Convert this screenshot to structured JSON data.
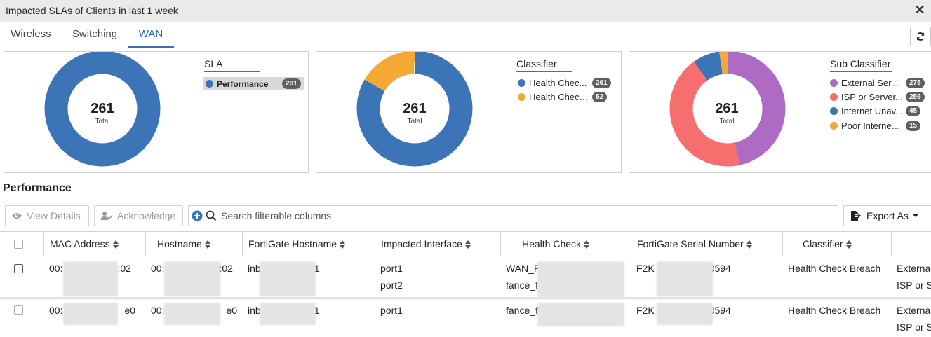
{
  "title_bar": {
    "title": "Impacted SLAs of Clients in last 1 week"
  },
  "tabs": [
    {
      "label": "Wireless",
      "active": false
    },
    {
      "label": "Switching",
      "active": false
    },
    {
      "label": "WAN",
      "active": true
    }
  ],
  "cards": [
    {
      "legend_title": "SLA",
      "center_value": "261",
      "center_label": "Total",
      "items": [
        {
          "label": "Performance",
          "count": "261",
          "color": "#3b74b7"
        }
      ]
    },
    {
      "legend_title": "Classifier",
      "center_value": "261",
      "center_label": "Total",
      "items": [
        {
          "label": "Health Chec...",
          "count": "261",
          "color": "#3b74b7"
        },
        {
          "label": "Health Check ...",
          "count": "52",
          "color": "#f5a935"
        }
      ]
    },
    {
      "legend_title": "Sub Classifier",
      "center_value": "261",
      "center_label": "Total",
      "items": [
        {
          "label": "External Ser...",
          "count": "275",
          "color": "#ad6bc4"
        },
        {
          "label": "ISP or Server...",
          "count": "256",
          "color": "#f76e6e"
        },
        {
          "label": "Internet Unav...",
          "count": "45",
          "color": "#3b74b7"
        },
        {
          "label": "Poor Internet ...",
          "count": "15",
          "color": "#f5a935"
        }
      ]
    }
  ],
  "section_title": "Performance",
  "toolbar": {
    "view_details": "View Details",
    "acknowledge": "Acknowledge",
    "search_placeholder": "Search filterable columns",
    "export_as": "Export As"
  },
  "table": {
    "columns": [
      "MAC Address",
      "Hostname",
      "FortiGate Hostname",
      "Impacted Interface",
      "Health Check",
      "FortiGate Serial Number",
      "Classifier"
    ],
    "rows": [
      {
        "mac_prefix": "00:",
        "mac_suffix": ":02",
        "host_prefix": "00:",
        "host_suffix": ":02",
        "fg_host_prefix": "inb",
        "fg_host_suffix": "1",
        "interfaces": [
          "port1",
          "port2"
        ],
        "health_checks": [
          "WAN_P",
          "fance_f"
        ],
        "serial_prefix": "F2K",
        "serial_suffix": "0594",
        "classifier": "Health Check Breach",
        "sub_classifiers": [
          "Externa",
          "ISP or S"
        ]
      },
      {
        "mac_prefix": "00:",
        "mac_suffix": "e0",
        "host_prefix": "00:",
        "host_suffix": "e0",
        "fg_host_prefix": "inb",
        "fg_host_suffix": "1",
        "interfaces": [
          "port1"
        ],
        "health_checks": [
          "fance_f"
        ],
        "serial_prefix": "F2K",
        "serial_suffix": "0594",
        "classifier": "Health Check Breach",
        "sub_classifiers": [
          "Externa",
          "ISP or S"
        ]
      }
    ]
  }
}
